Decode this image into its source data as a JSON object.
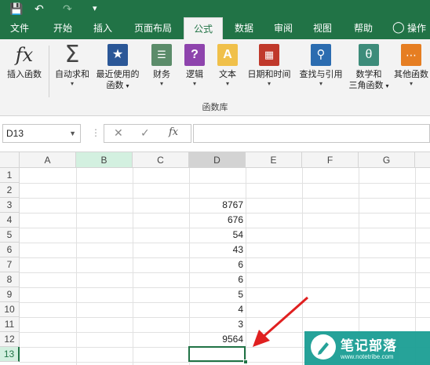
{
  "quick_access": {
    "save": "💾",
    "undo": "↶",
    "redo": "↷",
    "customize": "▾"
  },
  "tabs": [
    "文件",
    "开始",
    "插入",
    "页面布局",
    "公式",
    "数据",
    "审阅",
    "视图",
    "帮助",
    "操作"
  ],
  "active_tab": "公式",
  "ribbon": {
    "buttons": [
      {
        "label": "插入函数",
        "icon": "fx-icon"
      },
      {
        "label": "自动求和",
        "icon": "sigma-icon",
        "dropdown": "▾"
      },
      {
        "label": "最近使用的",
        "label2": "函数",
        "icon": "star-book-icon",
        "dropdown": "▾"
      },
      {
        "label": "财务",
        "icon": "money-book-icon",
        "dropdown": "▾"
      },
      {
        "label": "逻辑",
        "icon": "question-book-icon",
        "dropdown": "▾"
      },
      {
        "label": "文本",
        "icon": "text-book-icon",
        "dropdown": "▾"
      },
      {
        "label": "日期和时间",
        "icon": "calendar-book-icon",
        "dropdown": "▾"
      },
      {
        "label": "查找与引用",
        "icon": "search-book-icon",
        "dropdown": "▾"
      },
      {
        "label": "数学和",
        "label2": "三角函数",
        "icon": "theta-book-icon",
        "dropdown": "▾"
      },
      {
        "label": "其他函数",
        "icon": "more-book-icon",
        "dropdown": "▾"
      }
    ],
    "group_label": "函数库"
  },
  "formula_bar": {
    "name_box": "D13",
    "cancel": "✕",
    "enter": "✓",
    "fx": "fx",
    "value": ""
  },
  "grid": {
    "columns": [
      "A",
      "B",
      "C",
      "D",
      "E",
      "F",
      "G"
    ],
    "rows": [
      "1",
      "2",
      "3",
      "4",
      "5",
      "6",
      "7",
      "8",
      "9",
      "10",
      "11",
      "12",
      "13"
    ],
    "d_values": [
      "",
      "",
      "8767",
      "676",
      "54",
      "43",
      "6",
      "6",
      "5",
      "4",
      "3",
      "9564",
      ""
    ],
    "selected_cell": "D13"
  },
  "watermark": {
    "title": "笔记部落",
    "url": "www.notetribe.com"
  },
  "colors": {
    "accent": "#217346",
    "arrow": "#e02020",
    "watermark": "#1a9e94"
  }
}
